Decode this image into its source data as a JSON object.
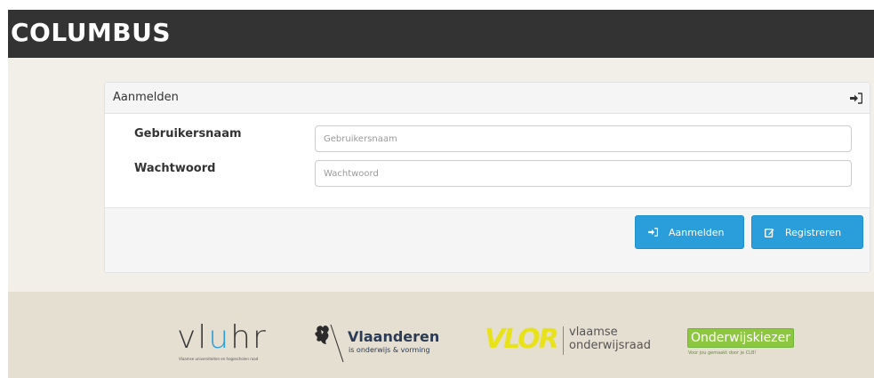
{
  "header": {
    "brand": "COLUMBUS"
  },
  "login_panel": {
    "title": "Aanmelden",
    "fields": [
      {
        "label": "Gebruikersnaam",
        "value": "",
        "placeholder": "Gebruikersnaam"
      },
      {
        "label": "Wachtwoord",
        "value": "",
        "placeholder": "Wachtwoord"
      }
    ],
    "buttons": {
      "login_label": "Aanmelden",
      "register_label": "Registreren"
    }
  },
  "footer": {
    "logos": [
      {
        "name": "vluhr",
        "sub": "Vlaamse universiteiten en hogescholen raad"
      },
      {
        "name": "Vlaanderen",
        "sub": "is onderwijs & vorming"
      },
      {
        "name": "VLOR",
        "line1": "vlaamse",
        "line2": "onderwijsraad"
      },
      {
        "name": "Onderwijskiezer",
        "sub": "Voor jou gemaakt door je CLB!"
      }
    ]
  },
  "colors": {
    "topbar": "#333333",
    "page_background": "#f1efe8",
    "footer_background": "#e5dfd1",
    "button_primary": "#2a9ddb",
    "vlor_yellow": "#e8e21a",
    "onderwijskiezer_green": "#8dc63f"
  },
  "icons": {
    "panel_header": "sign-in-icon",
    "login_button": "sign-in-icon",
    "register_button": "edit-icon"
  }
}
